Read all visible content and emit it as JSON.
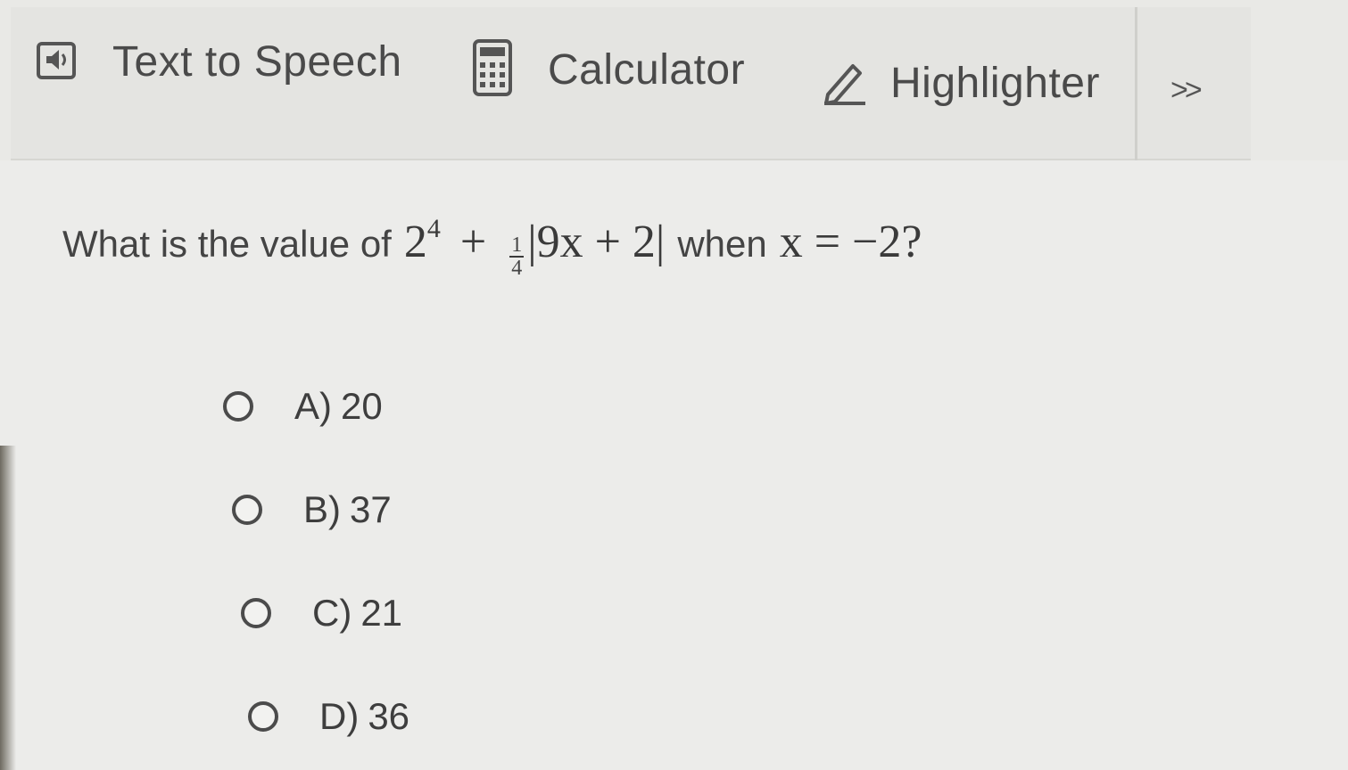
{
  "toolbar": {
    "text_to_speech": {
      "label": "Text to Speech",
      "icon": "speaker-icon"
    },
    "calculator": {
      "label": "Calculator",
      "icon": "calculator-icon"
    },
    "highlighter": {
      "label": "Highlighter",
      "icon": "pencil-icon"
    },
    "more": {
      "label": ">>"
    }
  },
  "question": {
    "prefix": "What is the value of",
    "math_base": "2",
    "math_exponent": "4",
    "plus1": "+",
    "frac_num": "1",
    "frac_den": "4",
    "abs_expr": "|9x + 2|",
    "middle": "when",
    "condition": "x = −2?"
  },
  "options": [
    {
      "letter": "A)",
      "value": "20"
    },
    {
      "letter": "B)",
      "value": "37"
    },
    {
      "letter": "C)",
      "value": "21"
    },
    {
      "letter": "D)",
      "value": "36"
    }
  ]
}
